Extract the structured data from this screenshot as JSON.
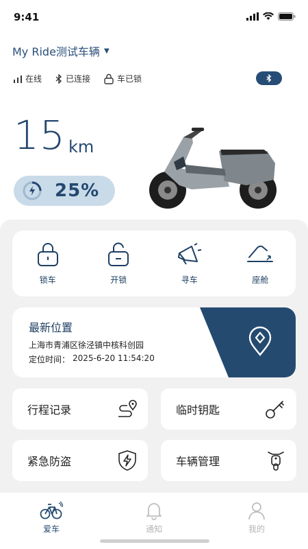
{
  "status_bar": {
    "time": "9:41"
  },
  "header": {
    "ride_name": "My Ride测试车辆"
  },
  "status": {
    "online": "在线",
    "connected": "已连接",
    "locked": "车已锁"
  },
  "range": {
    "value": "15",
    "unit": "km"
  },
  "battery": {
    "percent": "25%",
    "level": 0.25
  },
  "controls": [
    {
      "label": "锁车",
      "icon": "lock-icon"
    },
    {
      "label": "开锁",
      "icon": "unlock-icon"
    },
    {
      "label": "寻车",
      "icon": "horn-icon"
    },
    {
      "label": "座舱",
      "icon": "seat-icon"
    }
  ],
  "location": {
    "title": "最新位置",
    "address": "上海市青浦区徐泾镇中核科创园",
    "time_label": "定位时间：",
    "time_value": "2025-6-20 11:54:20"
  },
  "tiles": {
    "trip_records": "行程记录",
    "temp_key": "临时钥匙",
    "anti_theft": "紧急防盗",
    "vehicle_mgmt": "车辆管理"
  },
  "tabs": [
    {
      "label": "爱车",
      "active": true
    },
    {
      "label": "通知",
      "active": false
    },
    {
      "label": "我的",
      "active": false
    }
  ],
  "colors": {
    "accent": "#244a70",
    "pill": "#c9dbe9",
    "panel": "#f1f1f1"
  }
}
